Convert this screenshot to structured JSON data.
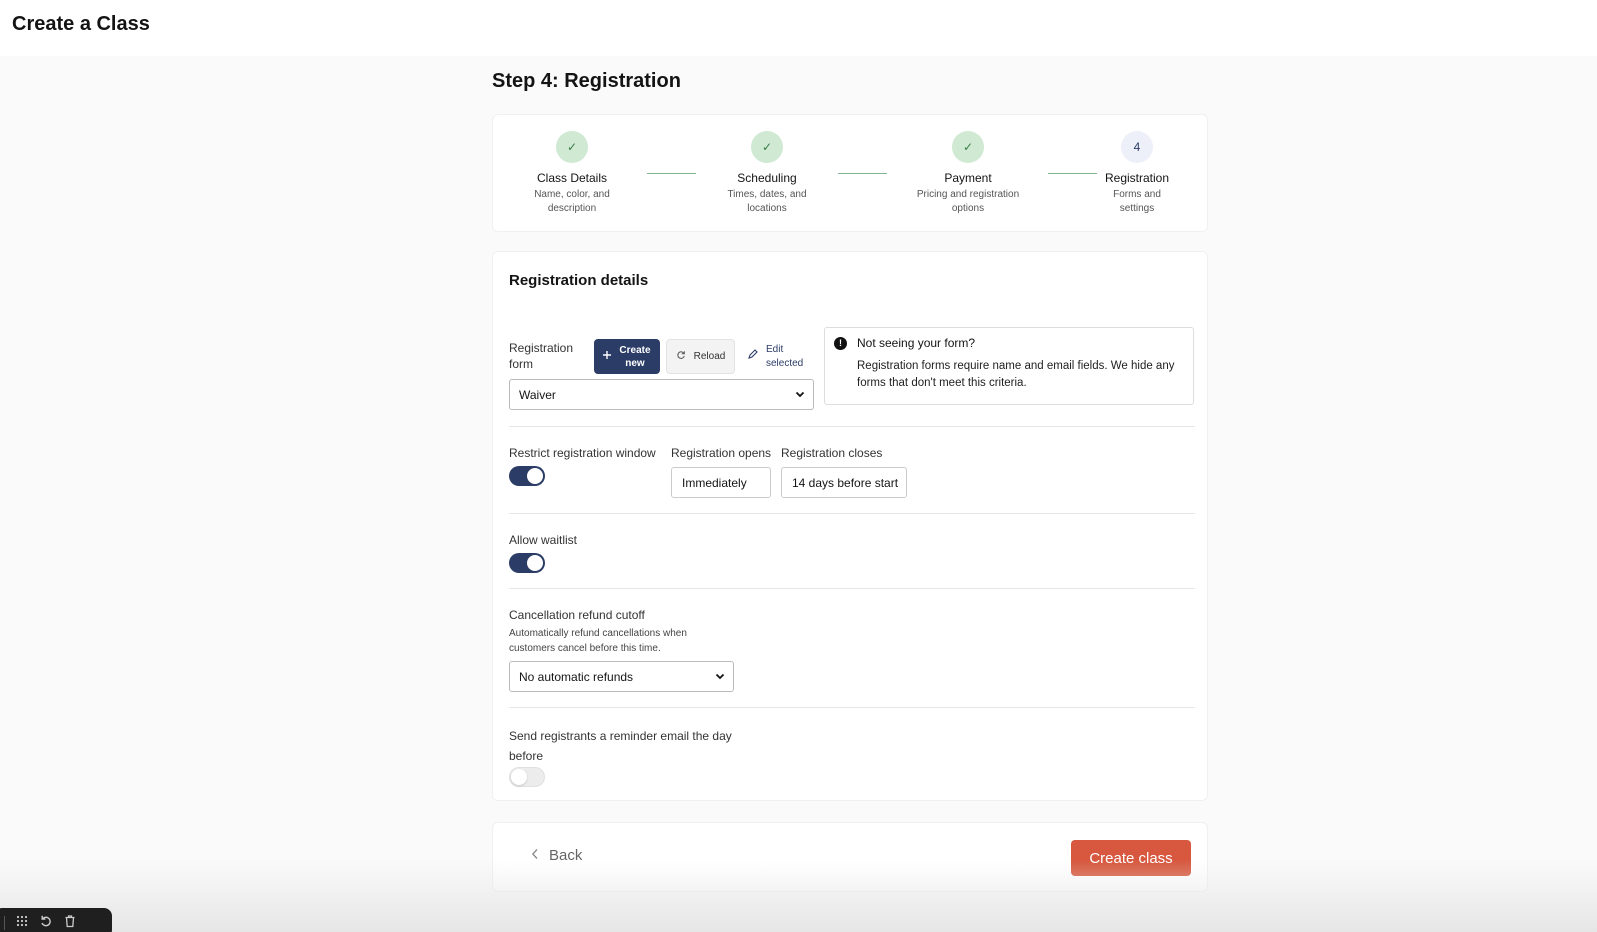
{
  "header": {
    "title": "Create a Class"
  },
  "page": {
    "step_title": "Step 4: Registration"
  },
  "stepper": [
    {
      "label": "Class Details",
      "desc": "Name, color, and description",
      "status": "done",
      "marker": "✓"
    },
    {
      "label": "Scheduling",
      "desc": "Times, dates, and locations",
      "status": "done",
      "marker": "✓"
    },
    {
      "label": "Payment",
      "desc": "Pricing and registration options",
      "status": "done",
      "marker": "✓"
    },
    {
      "label": "Registration",
      "desc": "Forms and settings",
      "status": "current",
      "marker": "4"
    }
  ],
  "details": {
    "title": "Registration details",
    "form_label": "Registration form",
    "create_new_label": "Create new",
    "reload_label": "Reload",
    "edit_selected_label": "Edit selected",
    "form_selected": "Waiver",
    "info_title": "Not seeing your form?",
    "info_body": "Registration forms require name and email fields. We hide any forms that don't meet this criteria.",
    "restrict_label": "Restrict registration window",
    "restrict_on": true,
    "opens_label": "Registration opens",
    "opens_value": "Immediately",
    "closes_label": "Registration closes",
    "closes_value": "14 days before start",
    "waitlist_label": "Allow waitlist",
    "waitlist_on": true,
    "refund_label": "Cancellation refund cutoff",
    "refund_desc": "Automatically refund cancellations when customers cancel before this time.",
    "refund_selected": "No automatic refunds",
    "reminder_label": "Send registrants a reminder email the day before",
    "reminder_on": false
  },
  "footer": {
    "back_label": "Back",
    "create_label": "Create class"
  },
  "colors": {
    "primary": "#2b3c66",
    "accent": "#d7583f",
    "step_done": "#cfe9d2",
    "step_line": "#86b594"
  },
  "icons": [
    "check-icon",
    "plus-icon",
    "reload-icon",
    "pencil-icon",
    "info-icon",
    "chevron-down-icon",
    "chevron-left-icon",
    "grid-icon",
    "undo-icon",
    "trash-icon"
  ]
}
